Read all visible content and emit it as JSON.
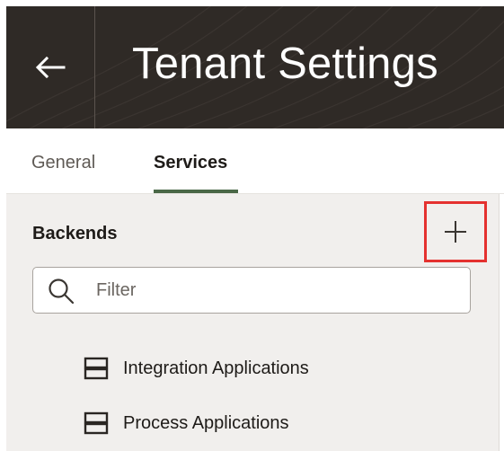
{
  "header": {
    "back_icon": "arrow-left-icon",
    "title": "Tenant Settings"
  },
  "tabs": [
    {
      "label": "General",
      "selected": false
    },
    {
      "label": "Services",
      "selected": true
    }
  ],
  "backends": {
    "heading": "Backends",
    "add_icon": "plus-icon",
    "filter": {
      "placeholder": "Filter",
      "value": "",
      "icon": "search-icon"
    },
    "items": [
      {
        "label": "Integration Applications",
        "icon": "server-icon"
      },
      {
        "label": "Process Applications",
        "icon": "server-icon"
      }
    ]
  },
  "colors": {
    "header_bg": "#2f2a26",
    "tab_accent": "#4a6847",
    "highlight_box": "#e4312f",
    "panel_bg": "#f1efed"
  }
}
